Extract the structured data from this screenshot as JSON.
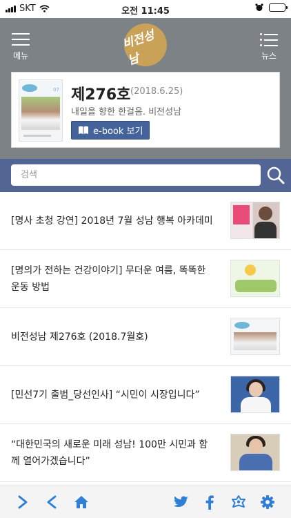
{
  "status_bar": {
    "carrier": "SKT",
    "time": "오전 11:45"
  },
  "header": {
    "menu_label": "메뉴",
    "news_label": "뉴스",
    "logo_text": "비전성남"
  },
  "current_issue": {
    "title": "제276호",
    "date": "(2018.6.25)",
    "subtitle": "내일을 향한 한걸음. 비전성남",
    "ebook_button": "e-book 보기",
    "cover_label": "07"
  },
  "search": {
    "placeholder": "검색"
  },
  "articles": [
    {
      "title": "[명사 초청 강연] 2018년 7월 성남 행복 아카데미"
    },
    {
      "title": "[명의가 전하는 건강이야기] 무더운 여름, 똑똑한 운동 방법"
    },
    {
      "title": "비전성남 제276호 (2018.7월호)"
    },
    {
      "title": "[민선7기 출범_당선인사] “시민이 시장입니다”"
    },
    {
      "title": "“대한민국의 새로운 미래 성남! 100만 시민과 함께 열어가겠습니다”"
    }
  ],
  "toolbar": {
    "icons": [
      "forward-icon",
      "back-icon",
      "home-icon",
      "twitter-icon",
      "facebook-icon",
      "city-symbol-icon",
      "settings-icon"
    ]
  },
  "colors": {
    "header_bg": "#7d8287",
    "search_bg": "#526595",
    "ebook_button": "#44639a",
    "toolbar_icon": "#2f7fd6",
    "logo_gold": "#c9a258"
  }
}
